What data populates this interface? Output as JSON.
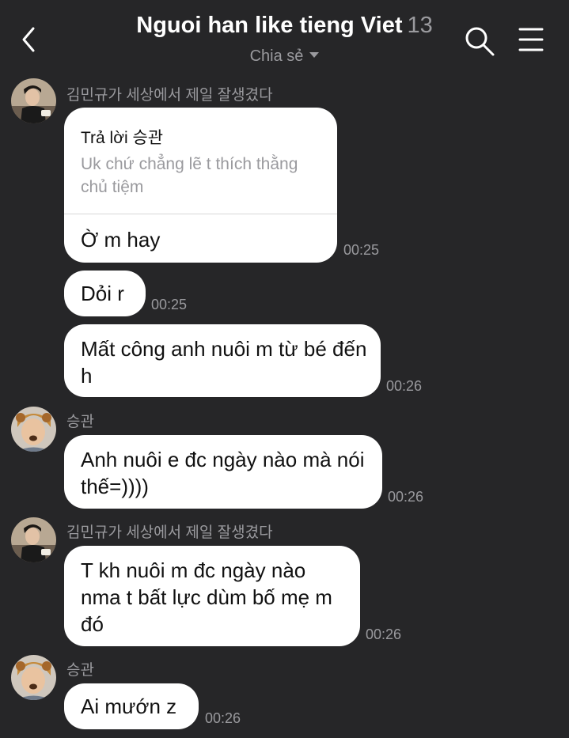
{
  "header": {
    "title": "Nguoi han like tieng Viet",
    "member_count": "13",
    "subtitle": "Chia sẻ"
  },
  "icons": {
    "back": "chevron-left-icon",
    "search": "search-icon",
    "menu": "hamburger-menu-icon"
  },
  "colors": {
    "background": "#262628",
    "bubble": "#ffffff",
    "secondary_text": "#9a9a9e"
  },
  "messages": [
    {
      "sender": "김민규가 세상에서 제일 잘생겼다",
      "reply_label": "Trả lời 승관",
      "reply_quote": "Uk chứ chẳng lẽ t thích thằng chủ tiệm",
      "text": "Ờ m hay",
      "time": "00:25"
    },
    {
      "text": "Dỏi r",
      "time": "00:25"
    },
    {
      "text": "Mất công anh nuôi m từ bé đến h",
      "time": "00:26"
    },
    {
      "sender": "승관",
      "text": "Anh nuôi e đc ngày nào mà nói thế=))))",
      "time": "00:26"
    },
    {
      "sender": "김민규가 세상에서 제일 잘생겼다",
      "text": "T kh nuôi m đc ngày nào nma t bất lực dùm bố mẹ m đó",
      "time": "00:26"
    },
    {
      "sender": "승관",
      "text": "Ai mướn z",
      "time": "00:26"
    }
  ]
}
